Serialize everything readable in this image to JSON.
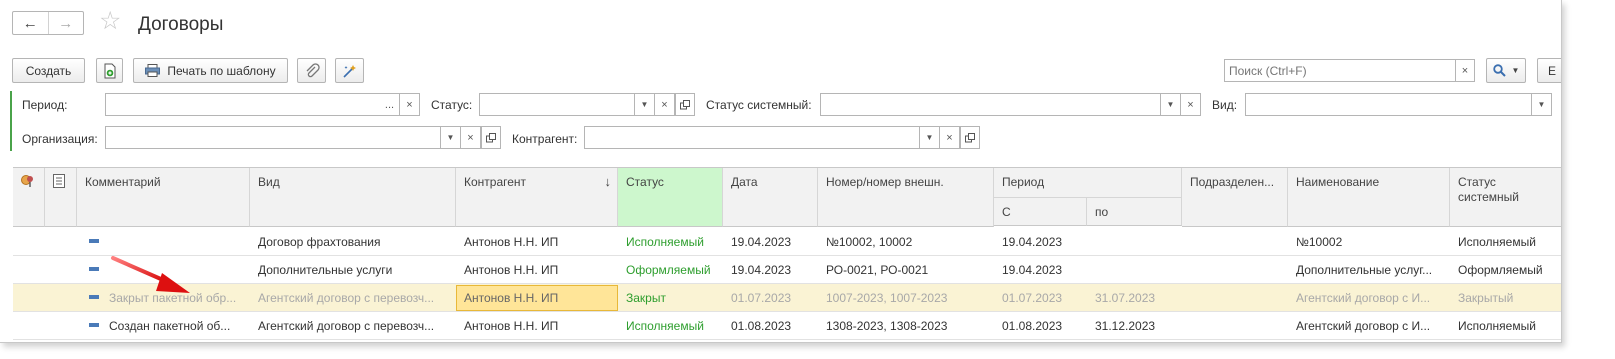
{
  "header": {
    "title": "Договоры",
    "back_icon": "←",
    "forward_icon": "→",
    "star_icon": "☆"
  },
  "toolbar": {
    "create_label": "Создать",
    "print_label": "Печать по шаблону",
    "search_placeholder": "Поиск (Ctrl+F)",
    "clear_icon": "×",
    "more_label": "Е"
  },
  "filters": {
    "period_label": "Период:",
    "status_label": "Статус:",
    "system_status_label": "Статус системный:",
    "kind_label": "Вид:",
    "organization_label": "Организация:",
    "counterparty_label": "Контрагент:",
    "ellipsis": "...",
    "clear_icon": "×",
    "drop_icon": "▼"
  },
  "table": {
    "columns": {
      "comment": "Комментарий",
      "kind": "Вид",
      "counterparty": "Контрагент",
      "status": "Статус",
      "date": "Дата",
      "number": "Номер/номер внешн.",
      "period": "Период",
      "period_from": "С",
      "period_to": "по",
      "department": "Подразделен...",
      "name": "Наименование",
      "system_status": "Статус системный"
    },
    "sort_indicator": "↓",
    "rows": [
      {
        "comment": "",
        "kind": "Договор фрахтования",
        "counterparty": "Антонов Н.Н. ИП",
        "status": "Исполняемый",
        "date": "19.04.2023",
        "number": "№10002, 10002",
        "from": "19.04.2023",
        "to": "",
        "department": "",
        "name": "№10002",
        "system_status": "Исполняемый"
      },
      {
        "comment": "",
        "kind": "Дополнительные услуги",
        "counterparty": "Антонов Н.Н. ИП",
        "status": "Оформляемый",
        "date": "19.04.2023",
        "number": "РО-0021, РО-0021",
        "from": "19.04.2023",
        "to": "",
        "department": "",
        "name": "Дополнительные услуг...",
        "system_status": "Оформляемый"
      },
      {
        "comment": "Закрыт пакетной обр...",
        "kind": "Агентский договор с перевозч...",
        "counterparty": "Антонов Н.Н. ИП",
        "status": "Закрыт",
        "date": "01.07.2023",
        "number": "1007-2023, 1007-2023",
        "from": "01.07.2023",
        "to": "31.07.2023",
        "department": "",
        "name": "Агентский договор с И...",
        "system_status": "Закрытый"
      },
      {
        "comment": "Создан пакетной об...",
        "kind": "Агентский договор с перевозч...",
        "counterparty": "Антонов Н.Н. ИП",
        "status": "Исполняемый",
        "date": "01.08.2023",
        "number": "1308-2023, 1308-2023",
        "from": "01.08.2023",
        "to": "31.12.2023",
        "department": "",
        "name": "Агентский договор с И...",
        "system_status": "Исполняемый"
      }
    ]
  },
  "colors": {
    "status_green": "#2e9e2e",
    "selected_row": "#faf3d4",
    "status_header": "#cdf7cd",
    "arrow": "#e02020"
  }
}
